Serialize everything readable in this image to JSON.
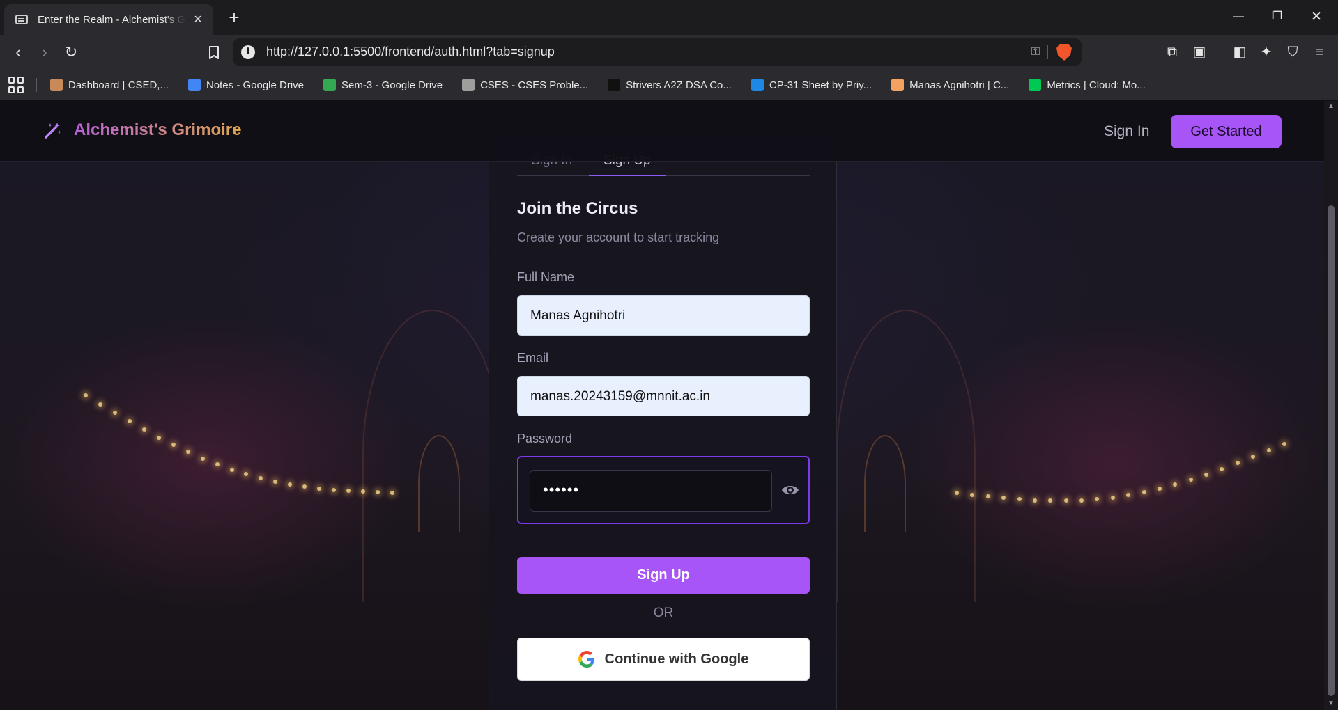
{
  "browser": {
    "tab_title": "Enter the Realm - Alchemist's Grimoire",
    "url": "http://127.0.0.1:5500/frontend/auth.html?tab=signup",
    "bookmarks": [
      {
        "label": "Dashboard | CSED,...",
        "color": "#c98a5a"
      },
      {
        "label": "Notes - Google Drive",
        "color": "#4285f4"
      },
      {
        "label": "Sem-3 - Google Drive",
        "color": "#34a853"
      },
      {
        "label": "CSES - CSES Proble...",
        "color": "#9e9e9e"
      },
      {
        "label": "Strivers A2Z DSA Co...",
        "color": "#111111"
      },
      {
        "label": "CP-31 Sheet by Priy...",
        "color": "#1e88e5"
      },
      {
        "label": "Manas Agnihotri | C...",
        "color": "#f4a261"
      },
      {
        "label": "Metrics | Cloud: Mo...",
        "color": "#00c853"
      }
    ]
  },
  "navbar": {
    "brand": "Alchemist's Grimoire",
    "sign_in": "Sign In",
    "get_started": "Get Started"
  },
  "auth": {
    "tabs": {
      "signin": "Sign In",
      "signup": "Sign Up",
      "active": "signup"
    },
    "title": "Join the Circus",
    "subtitle": "Create your account to start tracking",
    "fullname_label": "Full Name",
    "fullname_value": "Manas Agnihotri",
    "email_label": "Email",
    "email_value": "manas.20243159@mnnit.ac.in",
    "password_label": "Password",
    "password_masked": "••••••",
    "submit": "Sign Up",
    "divider": "OR",
    "google": "Continue with Google"
  },
  "colors": {
    "accent": "#a855f7",
    "background": "#121015"
  }
}
